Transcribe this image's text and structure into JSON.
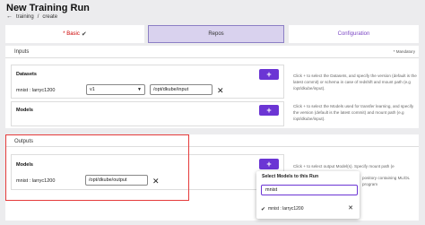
{
  "header": {
    "title": "New Training Run",
    "breadcrumb": [
      "training",
      "/",
      "create"
    ]
  },
  "tabs": [
    {
      "label": "* Basic",
      "state": "complete"
    },
    {
      "label": "Repos",
      "state": "active"
    },
    {
      "label": "Configuration",
      "state": "inactive"
    }
  ],
  "inputs": {
    "label": "Inputs",
    "mandatory_note": "* Mandatory",
    "datasets": {
      "title": "Datasets",
      "row_name": "mnist : larryc1200",
      "version": "v1",
      "mount_path": "/opt/dkube/input",
      "help": "Click + to select the Datasets, and specify the version (default is the latest commit) or schema in case of redshift and mount path (e.g /opt/dkube/input)."
    },
    "models": {
      "title": "Models",
      "help": "Click + to select the Models used for transfer learning, and specify the version (default is the latest commit) and mount path (e.g /opt/dkube/input)."
    }
  },
  "outputs": {
    "label": "Outputs",
    "models": {
      "title": "Models",
      "row_name": "mnist : larryc1200",
      "mount_path": "/opt/dkube/output",
      "help_visible_1": "Click + to select output Model(s). Specify mount path (e",
      "help_visible_2": "pository containing ML/DL",
      "help_visible_3": "program"
    }
  },
  "dropdown": {
    "title": "Select Models to this Run",
    "search_value": "mnist",
    "selected_item": "mnist : larryc1200"
  },
  "icons": {
    "back": "←",
    "check": "✔",
    "caret": "▼",
    "close": "✕",
    "plus": "+"
  },
  "colors": {
    "accent": "#6b35d4",
    "highlight": "#e53b3b",
    "active_tab_bg": "#d9d2ee"
  }
}
